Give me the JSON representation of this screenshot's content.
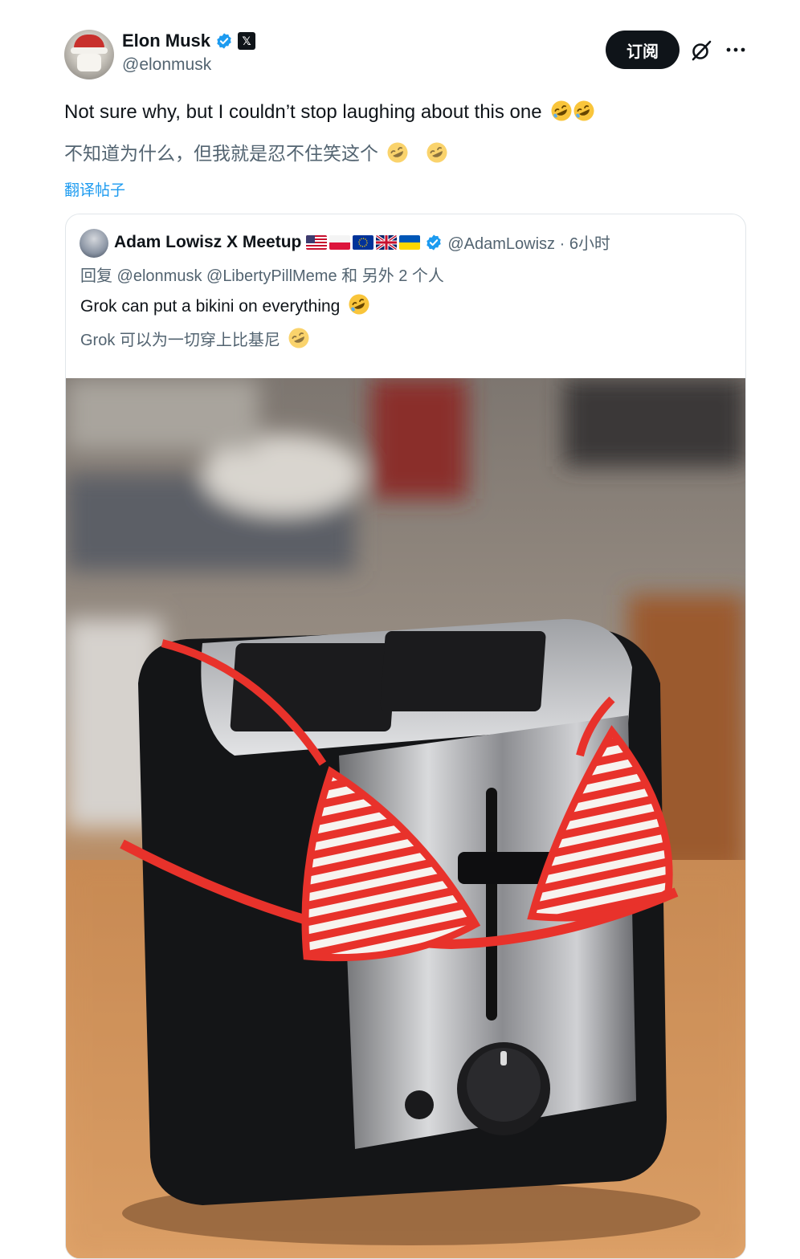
{
  "author": {
    "name": "Elon Musk",
    "handle": "@elonmusk",
    "x_badge": "𝕏"
  },
  "header": {
    "subscribe_label": "订阅",
    "grok_icon": "grok-slash-icon",
    "more_icon": "more-horizontal-icon"
  },
  "tweet": {
    "text": "Not sure why, but I couldn’t stop laughing about this one",
    "text_translated": "不知道为什么，但我就是忍不住笑这个",
    "emoji": "rolling-on-floor-laughing",
    "translate_label": "翻译帖子"
  },
  "quote": {
    "name": "Adam Lowisz X Meetup",
    "flags": [
      "us",
      "pl",
      "eu",
      "gb",
      "ua"
    ],
    "handle_time": "@AdamLowisz · 6小时",
    "reply_to": "回复 @elonmusk @LibertyPillMeme 和 另外 2 个人",
    "text": "Grok can put a bikini on everything",
    "text_translated": "Grok 可以为一切穿上比基尼",
    "image_alt": "Toaster wearing a red and white striped bikini top"
  },
  "colors": {
    "link": "#1d9bf0",
    "verified": "#1d9bf0",
    "secondary_text": "#536471",
    "primary_text": "#0f1419"
  }
}
